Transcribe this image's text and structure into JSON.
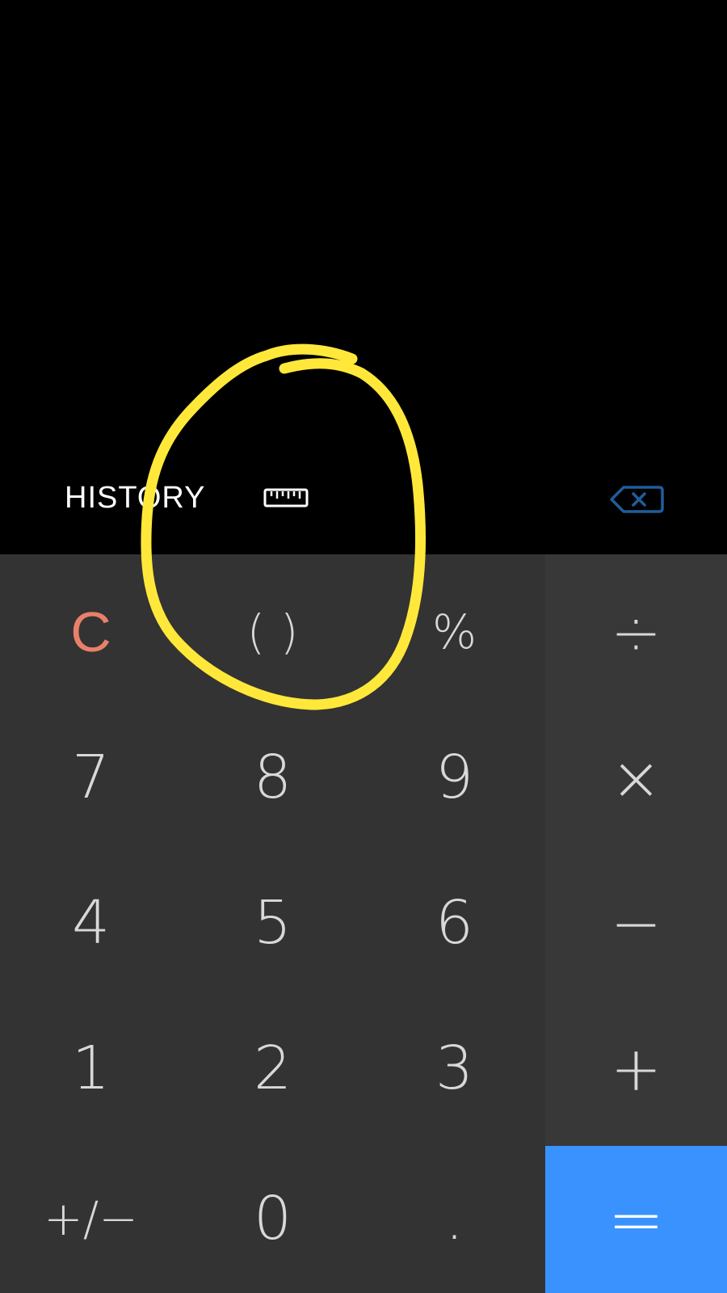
{
  "toolbar": {
    "history_label": "HISTORY",
    "ruler_icon": "ruler-icon",
    "backspace_icon": "backspace-icon"
  },
  "keys": {
    "clear": "C",
    "parens": "( )",
    "percent": "%",
    "divide": "÷",
    "seven": "7",
    "eight": "8",
    "nine": "9",
    "multiply": "×",
    "four": "4",
    "five": "5",
    "six": "6",
    "minus": "−",
    "one": "1",
    "two": "2",
    "three": "3",
    "plus": "+",
    "plus_minus": "+/−",
    "zero": "0",
    "decimal": ".",
    "equals": "="
  },
  "colors": {
    "display_bg": "#000000",
    "keypad_bg": "#333333",
    "clear_key": "#e8806a",
    "equals_bg": "#3a92ff",
    "annotation": "#ffe83a",
    "backspace_icon": "#1f5d9c"
  }
}
